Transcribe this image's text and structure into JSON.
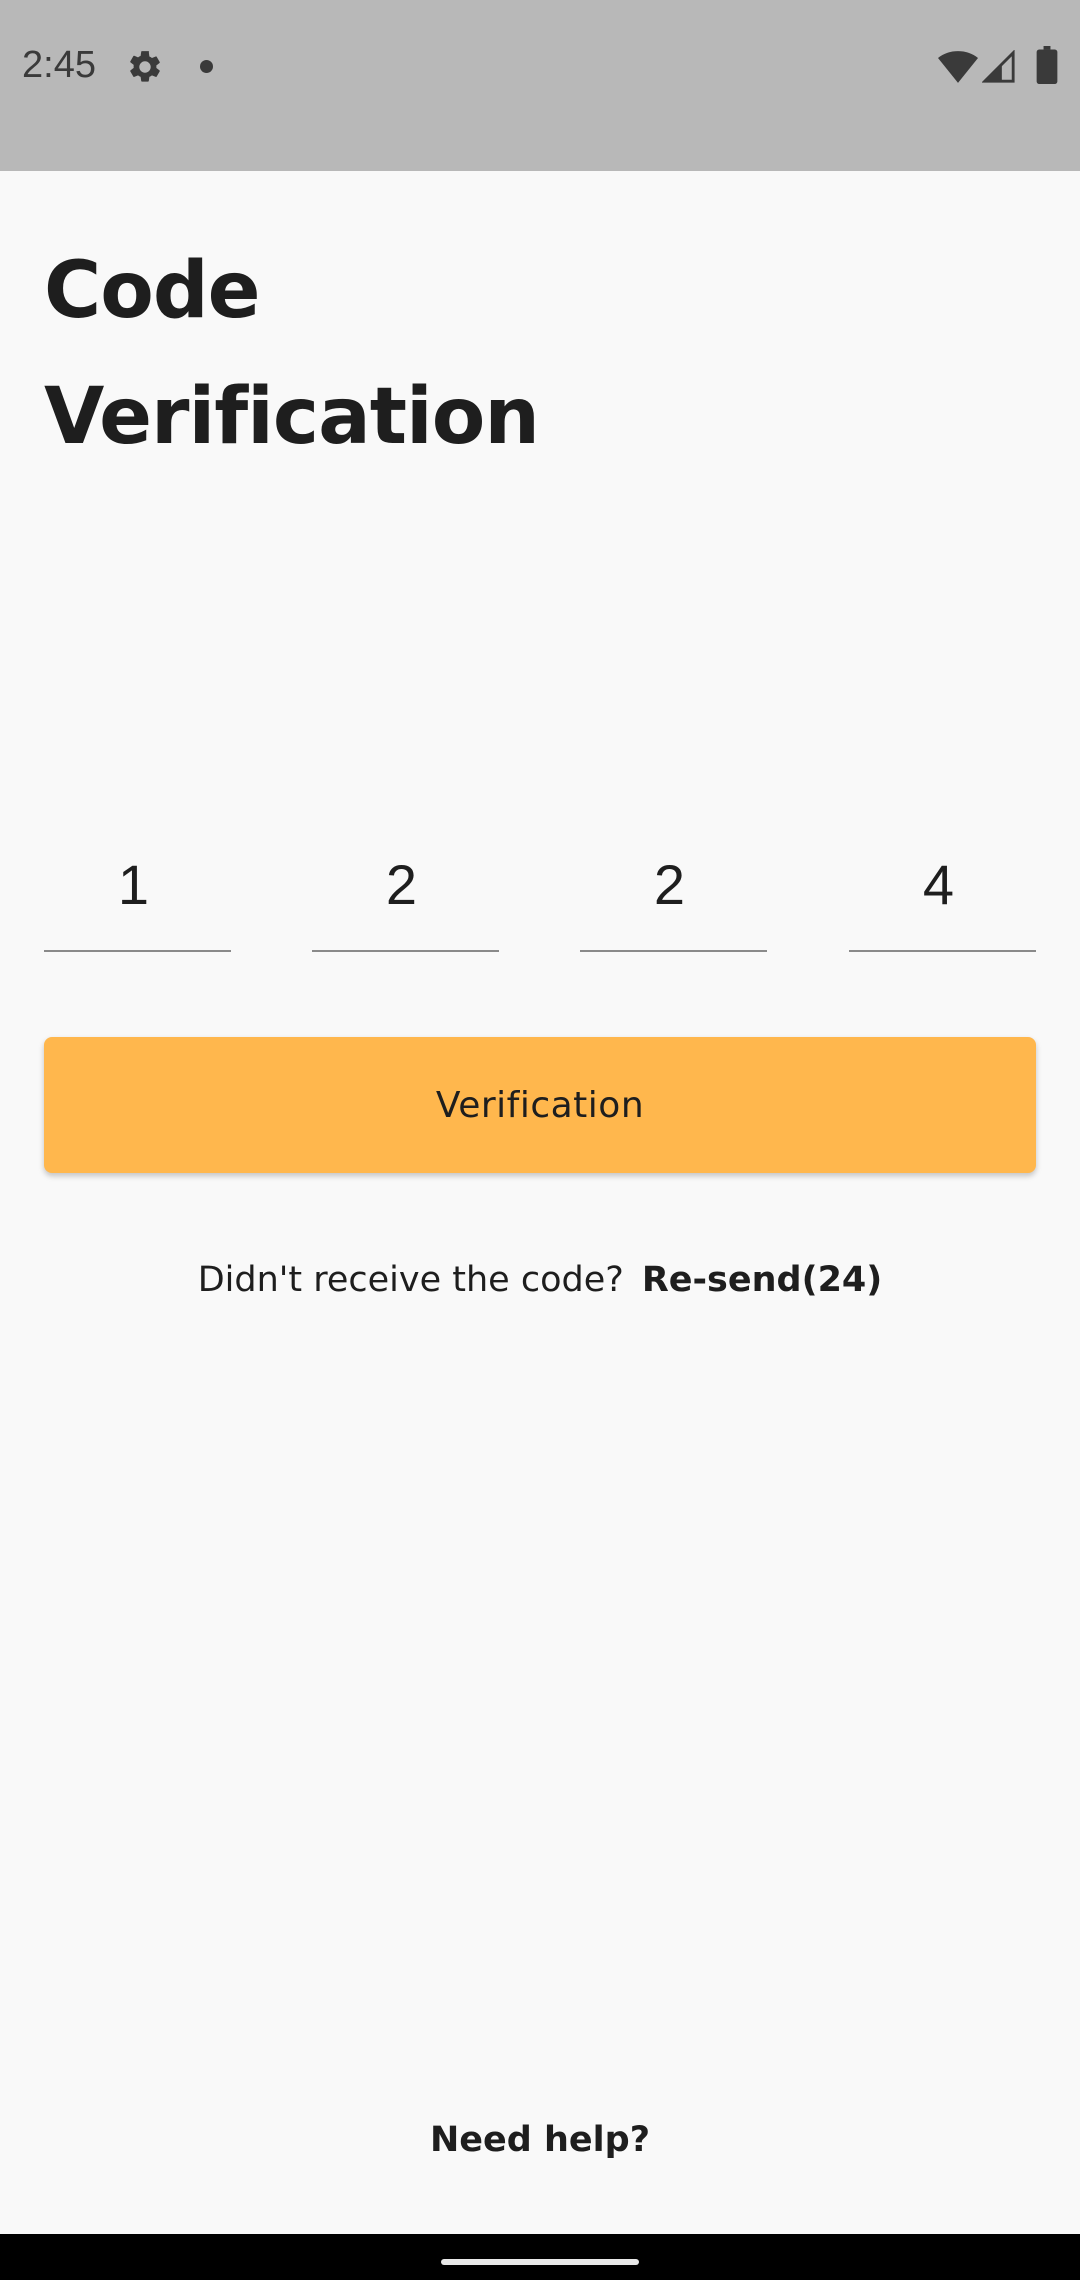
{
  "status_bar": {
    "time": "2:45",
    "icons": [
      "gear-icon",
      "notification-dot-icon",
      "wifi-icon",
      "signal-icon",
      "battery-icon"
    ]
  },
  "title": {
    "line1": "Code",
    "line2": "Verification"
  },
  "otp": {
    "digits": [
      "1",
      "2",
      "2",
      "4"
    ]
  },
  "verify_button": {
    "label": "Verification",
    "color": "#ffb74d"
  },
  "resend": {
    "prompt": "Didn't receive the code?",
    "link": "Re-send(24)"
  },
  "help": {
    "label": "Need help?"
  },
  "colors": {
    "background": "#f9f9f9",
    "status_bar": "#b8b8b8",
    "text": "#1e1e1e"
  }
}
